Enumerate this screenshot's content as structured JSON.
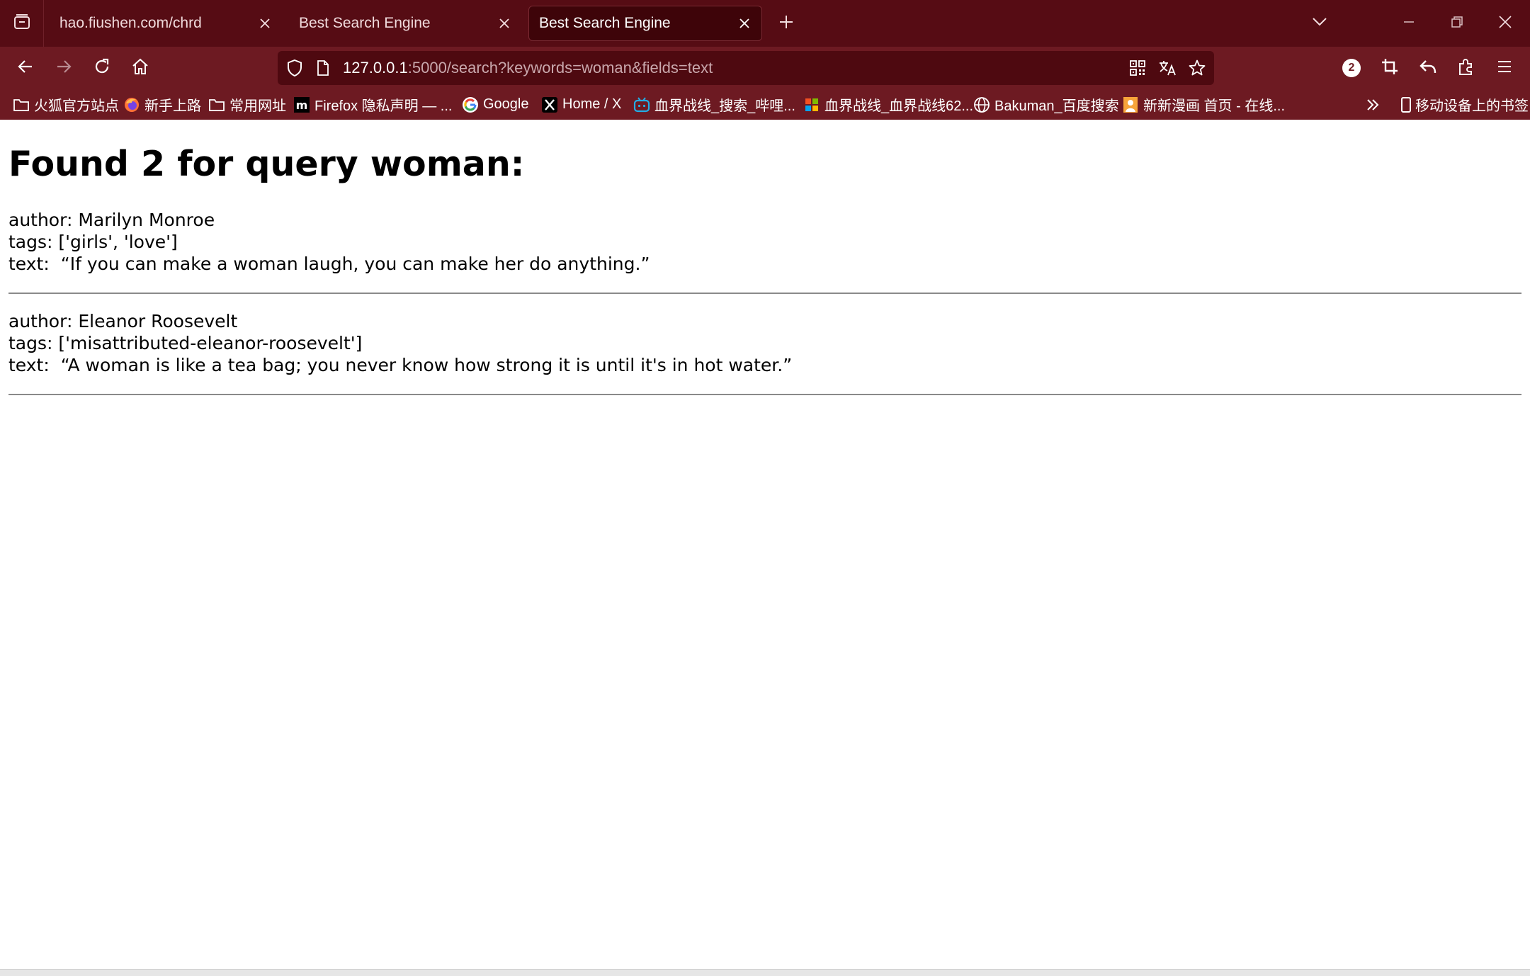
{
  "browser": {
    "tabs": [
      {
        "title": "hao.fiushen.com/chrd",
        "active": false
      },
      {
        "title": "Best Search Engine",
        "active": false
      },
      {
        "title": "Best Search Engine",
        "active": true
      }
    ],
    "url": {
      "host": "127.0.0.1",
      "path": ":5000/search?keywords=woman&fields=text"
    },
    "extension_badge": "2",
    "bookmarks": [
      {
        "label": "火狐官方站点",
        "icon": "folder-icon"
      },
      {
        "label": "新手上路",
        "icon": "firefox-icon"
      },
      {
        "label": "常用网址",
        "icon": "folder-icon"
      },
      {
        "label": "Firefox 隐私声明 — ...",
        "icon": "mozilla-icon"
      },
      {
        "label": "Google",
        "icon": "google-icon"
      },
      {
        "label": "Home / X",
        "icon": "x-icon"
      },
      {
        "label": "血界战线_搜索_哔哩...",
        "icon": "bilibili-icon"
      },
      {
        "label": "血界战线_血界战线62...",
        "icon": "windows-icon"
      },
      {
        "label": "Bakuman_百度搜索",
        "icon": "globe-icon"
      },
      {
        "label": "新新漫画 首页 - 在线...",
        "icon": "manga-icon"
      }
    ],
    "mobile_bookmarks": "移动设备上的书签",
    "colors": {
      "tabbar": "#560c14",
      "toolbar": "#6d1a22",
      "urlbar": "#4e0910"
    }
  },
  "page": {
    "heading": "Found 2 for query woman:",
    "results": [
      {
        "author_label": "author:",
        "author": "Marilyn Monroe",
        "tags_label": "tags:",
        "tags": "['girls', 'love']",
        "text_label": "text:",
        "text": "“If you can make a woman laugh, you can make her do anything.”"
      },
      {
        "author_label": "author:",
        "author": "Eleanor Roosevelt",
        "tags_label": "tags:",
        "tags": "['misattributed-eleanor-roosevelt']",
        "text_label": "text:",
        "text": "“A woman is like a tea bag; you never know how strong it is until it's in hot water.”"
      }
    ]
  }
}
